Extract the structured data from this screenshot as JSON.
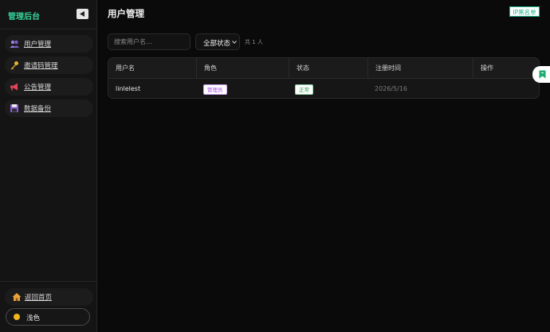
{
  "sidebar": {
    "brand_title": "管理后台",
    "nav_items": [
      {
        "label": "用户管理",
        "icon": "users-icon"
      },
      {
        "label": "邀请码管理",
        "icon": "key-icon"
      },
      {
        "label": "公告管理",
        "icon": "megaphone-icon"
      },
      {
        "label": "数据备份",
        "icon": "floppy-disk-icon"
      }
    ],
    "footer": {
      "home_label": "返回首页",
      "theme_label": "浅色"
    }
  },
  "header": {
    "title": "用户管理",
    "ip_blacklist_label": "IP黑名单"
  },
  "filters": {
    "search_placeholder": "搜索用户名...",
    "status_selected": "全部状态",
    "total_label": "共 1 人"
  },
  "table": {
    "columns": [
      "用户名",
      "角色",
      "状态",
      "注册时间",
      "操作"
    ],
    "rows": [
      {
        "username": "linlelest",
        "role": "管理员",
        "status": "正常",
        "registered": "2026/5/16",
        "actions": ""
      }
    ]
  },
  "colors": {
    "accent": "#35d49a",
    "role_badge": "#a34ce0",
    "status_badge": "#2a9a4f",
    "theme_dot": "#f3b51d"
  }
}
